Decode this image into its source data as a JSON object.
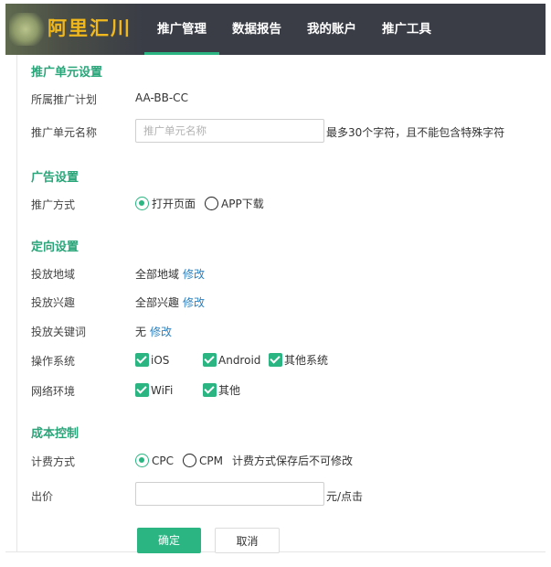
{
  "header": {
    "logo": "阿里汇川",
    "nav": [
      {
        "label": "推广管理",
        "active": true
      },
      {
        "label": "数据报告",
        "active": false
      },
      {
        "label": "我的账户",
        "active": false
      },
      {
        "label": "推广工具",
        "active": false
      }
    ]
  },
  "unit_settings": {
    "title": "推广单元设置",
    "plan_label": "所属推广计划",
    "plan_value": "AA-BB-CC",
    "name_label": "推广单元名称",
    "name_placeholder": "推广单元名称",
    "name_value": "",
    "name_hint": "最多30个字符，且不能包含特殊字符"
  },
  "ad_settings": {
    "title": "广告设置",
    "method_label": "推广方式",
    "options": [
      {
        "label": "打开页面",
        "selected": true
      },
      {
        "label": "APP下载",
        "selected": false
      }
    ]
  },
  "targeting": {
    "title": "定向设置",
    "region_label": "投放地域",
    "region_value": "全部地域",
    "interest_label": "投放兴趣",
    "interest_value": "全部兴趣",
    "keyword_label": "投放关键词",
    "keyword_value": "无",
    "edit_link": "修改",
    "os_label": "操作系统",
    "os_options": [
      {
        "label": "iOS",
        "checked": true
      },
      {
        "label": "Android",
        "checked": true
      },
      {
        "label": "其他系统",
        "checked": true
      }
    ],
    "network_label": "网络环境",
    "network_options": [
      {
        "label": "WiFi",
        "checked": true
      },
      {
        "label": "其他",
        "checked": true
      }
    ]
  },
  "cost": {
    "title": "成本控制",
    "billing_label": "计费方式",
    "billing_options": [
      {
        "label": "CPC",
        "selected": true
      },
      {
        "label": "CPM",
        "selected": false
      }
    ],
    "billing_hint": "计费方式保存后不可修改",
    "bid_label": "出价",
    "bid_value": "",
    "bid_unit": "元/点击"
  },
  "actions": {
    "confirm": "确定",
    "cancel": "取消"
  },
  "colors": {
    "accent": "#2bb583",
    "section_title": "#2aa57a",
    "link": "#2a7fbf",
    "warning": "#d9352b",
    "header_bg": "#3a3d46",
    "logo": "#f0b81c"
  }
}
